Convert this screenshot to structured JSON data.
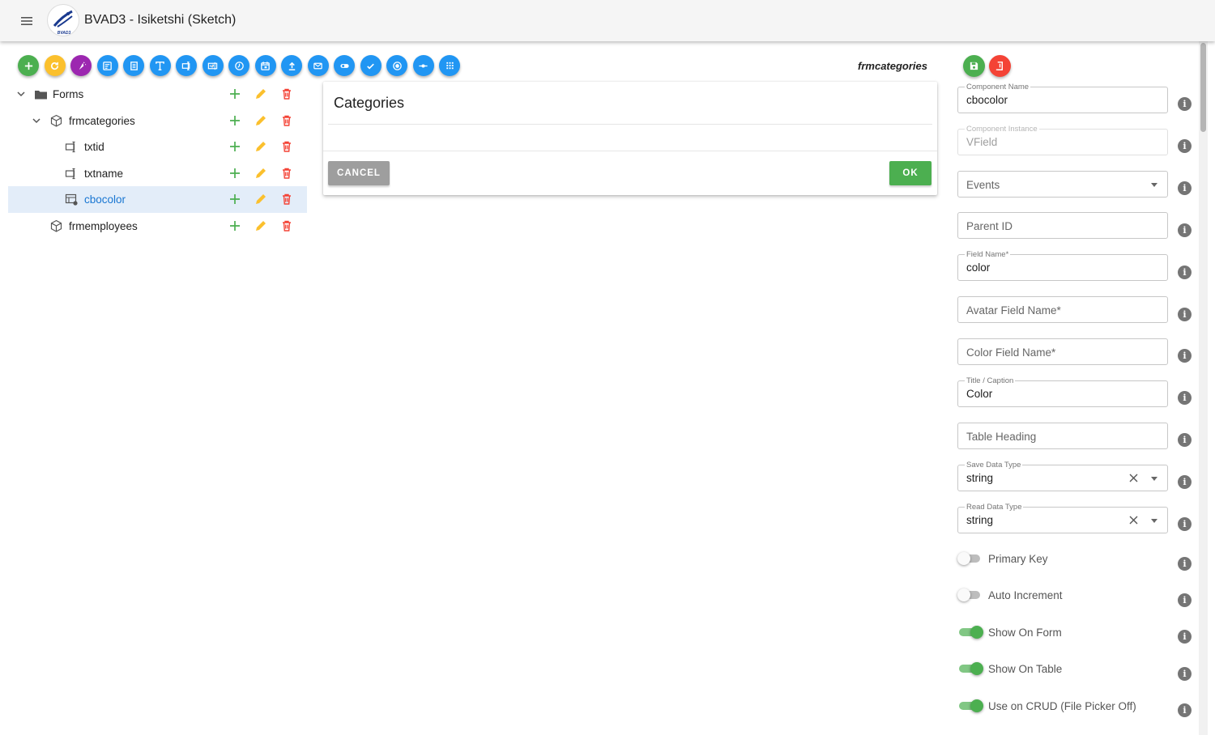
{
  "app": {
    "title": "BVAD3 - Isiketshi (Sketch)",
    "logo_text": "BVAD3"
  },
  "toolbar": {
    "buttons": [
      {
        "icon": "plus-icon",
        "color": "#4caf50"
      },
      {
        "icon": "refresh-icon",
        "color": "#fbc02d"
      },
      {
        "icon": "magic-icon",
        "color": "#9c27b0"
      },
      {
        "icon": "form-icon",
        "color": "#2196f3"
      },
      {
        "icon": "list-icon",
        "color": "#2196f3"
      },
      {
        "icon": "text-field-icon",
        "color": "#2196f3"
      },
      {
        "icon": "textbox-icon",
        "color": "#2196f3"
      },
      {
        "icon": "numeric-field-icon",
        "color": "#2196f3"
      },
      {
        "icon": "clock-icon",
        "color": "#2196f3"
      },
      {
        "icon": "calendar-icon",
        "color": "#2196f3"
      },
      {
        "icon": "upload-icon",
        "color": "#2196f3"
      },
      {
        "icon": "email-icon",
        "color": "#2196f3"
      },
      {
        "icon": "toggle-icon",
        "color": "#2196f3"
      },
      {
        "icon": "check-icon",
        "color": "#2196f3"
      },
      {
        "icon": "radio-icon",
        "color": "#2196f3"
      },
      {
        "icon": "slider-icon",
        "color": "#2196f3"
      },
      {
        "icon": "grid-icon",
        "color": "#2196f3"
      }
    ],
    "current_form": "frmcategories"
  },
  "tree": {
    "items": [
      {
        "label": "Forms",
        "icon": "folder-icon",
        "level": 0,
        "expanded": true
      },
      {
        "label": "frmcategories",
        "icon": "cube-icon",
        "level": 1,
        "expanded": true
      },
      {
        "label": "txtid",
        "icon": "textbox-icon",
        "level": 2
      },
      {
        "label": "txtname",
        "icon": "textbox-icon",
        "level": 2
      },
      {
        "label": "cbocolor",
        "icon": "combobox-icon",
        "level": 2,
        "selected": true
      },
      {
        "label": "frmemployees",
        "icon": "cube-icon",
        "level": 1
      }
    ]
  },
  "dialog": {
    "title": "Categories",
    "cancel_label": "CANCEL",
    "ok_label": "OK"
  },
  "props": {
    "component_name": {
      "label": "Component Name",
      "value": "cbocolor"
    },
    "component_instance": {
      "label": "Component Instance",
      "value": "VField"
    },
    "events": {
      "placeholder": "Events"
    },
    "parent_id": {
      "placeholder": "Parent ID"
    },
    "field_name": {
      "label": "Field Name*",
      "value": "color"
    },
    "avatar_field_name": {
      "placeholder": "Avatar Field Name*"
    },
    "color_field_name": {
      "placeholder": "Color Field Name*"
    },
    "title_caption": {
      "label": "Title / Caption",
      "value": "Color"
    },
    "table_heading": {
      "placeholder": "Table Heading"
    },
    "save_data_type": {
      "label": "Save Data Type",
      "value": "string"
    },
    "read_data_type": {
      "label": "Read Data Type",
      "value": "string"
    },
    "switches": [
      {
        "label": "Primary Key",
        "on": false
      },
      {
        "label": "Auto Increment",
        "on": false
      },
      {
        "label": "Show On Form",
        "on": true
      },
      {
        "label": "Show On Table",
        "on": true
      },
      {
        "label": "Use on CRUD (File Picker Off)",
        "on": true
      }
    ],
    "info_glyph": "i"
  },
  "colors": {
    "primary": "#2196f3",
    "success": "#4caf50",
    "danger": "#f44336",
    "warning": "#fbc02d"
  }
}
